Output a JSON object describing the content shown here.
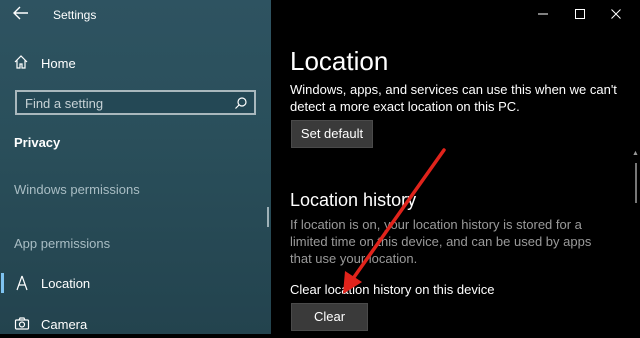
{
  "sidebar": {
    "app_title": "Settings",
    "home_label": "Home",
    "search_placeholder": "Find a setting",
    "section_title": "Privacy",
    "windows_permissions_label": "Windows permissions",
    "app_permissions_label": "App permissions",
    "items": [
      {
        "label": "Location",
        "icon": "location-icon",
        "selected": true
      },
      {
        "label": "Camera",
        "icon": "camera-icon",
        "selected": false
      }
    ]
  },
  "window_controls": {
    "minimize": "—",
    "maximize": "☐",
    "close": "✕"
  },
  "main": {
    "title": "Location",
    "description": "Windows, apps, and services can use this when we can't detect a more exact location on this PC.",
    "set_default_label": "Set default",
    "history_title": "Location history",
    "history_description": "If location is on, your location history is stored for a limited time on this device, and can be used by apps that use your location.",
    "clear_label_text": "Clear location history on this device",
    "clear_button_label": "Clear"
  },
  "colors": {
    "accent": "#7fc3f0",
    "arrow": "#e0231b",
    "sidebar_bg": "#2a4f5b"
  }
}
